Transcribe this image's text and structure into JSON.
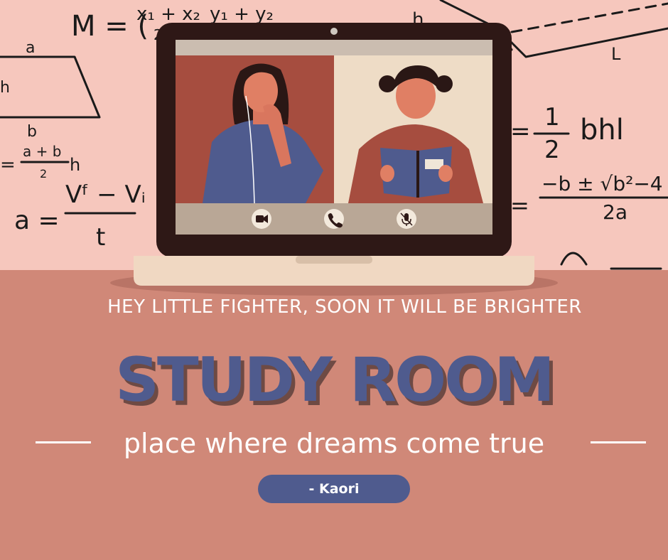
{
  "colors": {
    "background_top": "#f6c7bd",
    "desk": "#d08878",
    "laptop_frame": "#2e1816",
    "accent_blue": "#4f5b8e",
    "text_white": "#ffffff"
  },
  "formulas": {
    "midpoint_left": "M = (",
    "midpoint_x": "x₁ + x₂",
    "midpoint_y": "y₁ + y₂",
    "midpoint_denom": "2",
    "trap_a": "a",
    "trap_h": "h",
    "trap_b": "b",
    "area_lhs": "=",
    "area_frac": "a + b",
    "area_denom": "2",
    "area_h": "h",
    "accel_lhs": "a =",
    "accel_num": "Vᶠ − Vᵢ",
    "accel_den": "t",
    "prism_h": "h",
    "prism_l": "L",
    "vol_eq": "=",
    "vol_num": "1",
    "vol_den": "2",
    "vol_rest": "bhl",
    "quad_eq": "=",
    "quad_num": "−b ± √b²−4",
    "quad_den": "2a"
  },
  "video_call": {
    "controls": {
      "camera_icon": "video-camera-icon",
      "phone_icon": "phone-icon",
      "mic_icon": "mic-off-icon"
    }
  },
  "quote": "HEY LITTLE FIGHTER, SOON IT WILL BE BRIGHTER",
  "title": "STUDY ROOM",
  "tagline": "place where dreams come true",
  "author": "- Kaori"
}
